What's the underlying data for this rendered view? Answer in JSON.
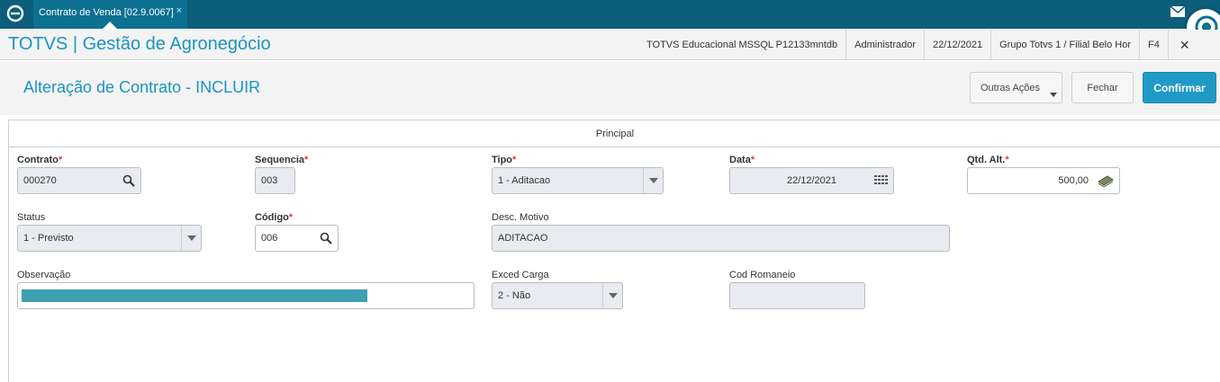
{
  "tabbar": {
    "tab_label": "Contrato de Venda [02.9.0067]",
    "tab_close": "×"
  },
  "header": {
    "app_title": "TOTVS | Gestão de Agronegócio",
    "environment": "TOTVS Educacional MSSQL P12133mntdb",
    "user": "Administrador",
    "date": "22/12/2021",
    "branch": "Grupo Totvs 1 / Filial Belo Hor",
    "shortcut": "F4",
    "close": "✕"
  },
  "titlebar": {
    "page_title": "Alteração de Contrato - INCLUIR",
    "outras_acoes": "Outras Ações",
    "fechar": "Fechar",
    "confirmar": "Confirmar"
  },
  "panel": {
    "tab_label": "Principal"
  },
  "form": {
    "contrato": {
      "label": "Contrato",
      "value": "000270"
    },
    "sequencia": {
      "label": "Sequencia",
      "value": "003"
    },
    "tipo": {
      "label": "Tipo",
      "value": "1 - Aditacao"
    },
    "data": {
      "label": "Data",
      "value": "22/12/2021"
    },
    "qtd_alt": {
      "label": "Qtd. Alt.",
      "value": "500,00"
    },
    "status": {
      "label": "Status",
      "value": "1 - Previsto"
    },
    "codigo": {
      "label": "Código",
      "value": "006"
    },
    "desc_motivo": {
      "label": "Desc. Motivo",
      "value": "ADITACAO"
    },
    "observacao": {
      "label": "Observação",
      "value": ""
    },
    "exced_carga": {
      "label": "Exced Carga",
      "value": "2 - Não"
    },
    "cod_romaneio": {
      "label": "Cod Romaneio",
      "value": ""
    },
    "required_mark": "*"
  },
  "colors": {
    "tabbar": "#0d5e7a",
    "accent": "#1b94c2",
    "confirm_button": "#1f9ac6",
    "selection": "#3d9fb0"
  }
}
